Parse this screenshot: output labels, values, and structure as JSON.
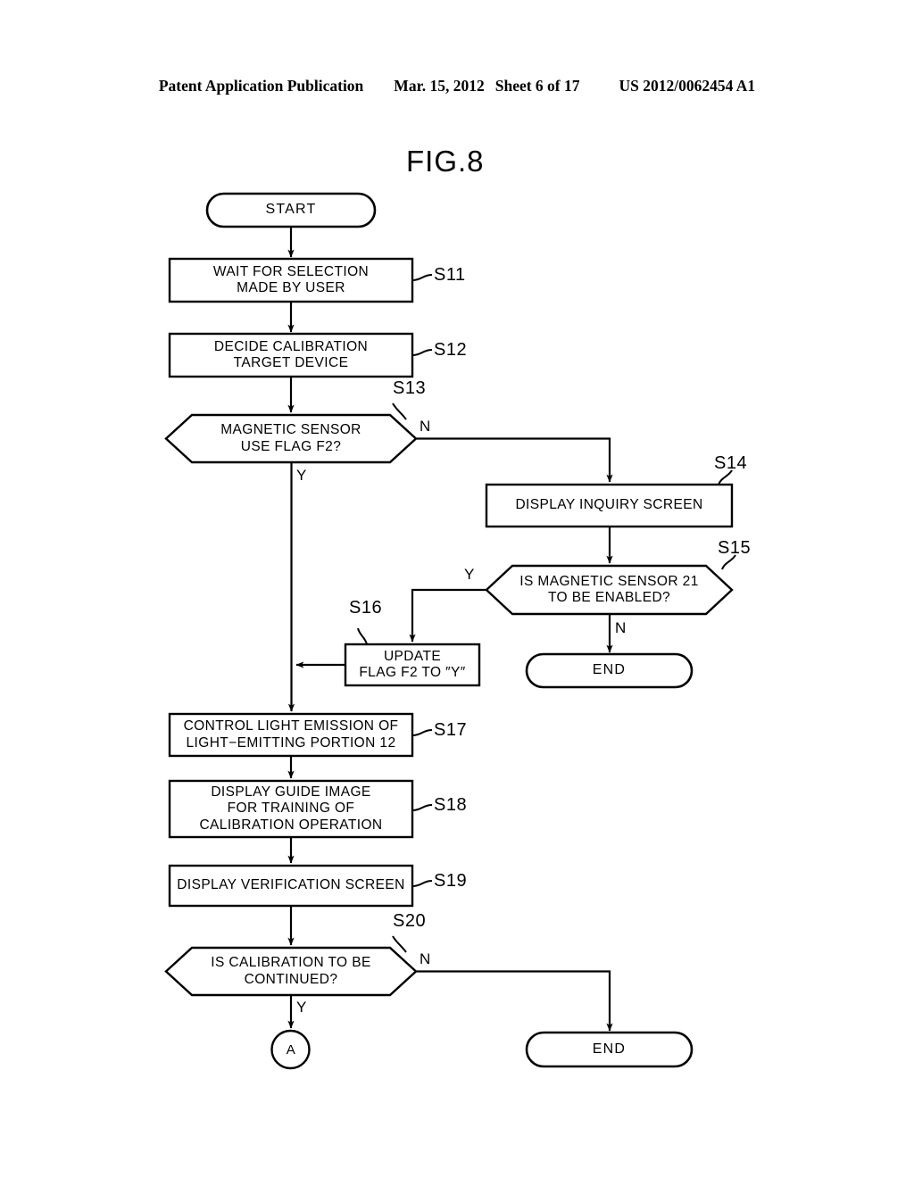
{
  "header": {
    "left": "Patent Application Publication",
    "date": "Mar. 15, 2012",
    "sheet": "Sheet 6 of 17",
    "pubnum": "US 2012/0062454 A1"
  },
  "figure": {
    "title": "FIG.8"
  },
  "nodes": {
    "start": {
      "label": "START",
      "shape": "terminator"
    },
    "s11": {
      "label_lines": [
        "WAIT FOR SELECTION",
        "MADE BY USER"
      ],
      "step": "S11",
      "shape": "process"
    },
    "s12": {
      "label_lines": [
        "DECIDE CALIBRATION",
        "TARGET DEVICE"
      ],
      "step": "S12",
      "shape": "process"
    },
    "s13": {
      "label_lines": [
        "MAGNETIC SENSOR",
        "USE FLAG F2?"
      ],
      "step": "S13",
      "shape": "decision"
    },
    "s14": {
      "label_lines": [
        "DISPLAY INQUIRY SCREEN"
      ],
      "step": "S14",
      "shape": "process"
    },
    "s15": {
      "label_lines": [
        "IS MAGNETIC SENSOR 21",
        "TO BE ENABLED?"
      ],
      "step": "S15",
      "shape": "decision"
    },
    "s16": {
      "label_lines": [
        "UPDATE",
        "FLAG F2 TO ″Y″"
      ],
      "step": "S16",
      "shape": "process"
    },
    "s17": {
      "label_lines": [
        "CONTROL LIGHT EMISSION OF",
        "LIGHT−EMITTING PORTION 12"
      ],
      "step": "S17",
      "shape": "process"
    },
    "s18": {
      "label_lines": [
        "DISPLAY GUIDE IMAGE",
        "FOR TRAINING OF",
        "CALIBRATION OPERATION"
      ],
      "step": "S18",
      "shape": "process"
    },
    "s19": {
      "label_lines": [
        "DISPLAY VERIFICATION SCREEN"
      ],
      "step": "S19",
      "shape": "process"
    },
    "s20": {
      "label_lines": [
        "IS CALIBRATION TO BE",
        "CONTINUED?"
      ],
      "step": "S20",
      "shape": "decision"
    },
    "end_mid": {
      "label": "END",
      "shape": "terminator"
    },
    "end_bottom": {
      "label": "END",
      "shape": "terminator"
    },
    "connector_a": {
      "label": "A",
      "shape": "connector"
    }
  },
  "branches": {
    "s13_no": "N",
    "s13_yes": "Y",
    "s15_yes": "Y",
    "s15_no": "N",
    "s20_no": "N",
    "s20_yes": "Y"
  },
  "colors": {
    "stroke": "#000000",
    "fill": "#ffffff",
    "text": "#000000"
  }
}
